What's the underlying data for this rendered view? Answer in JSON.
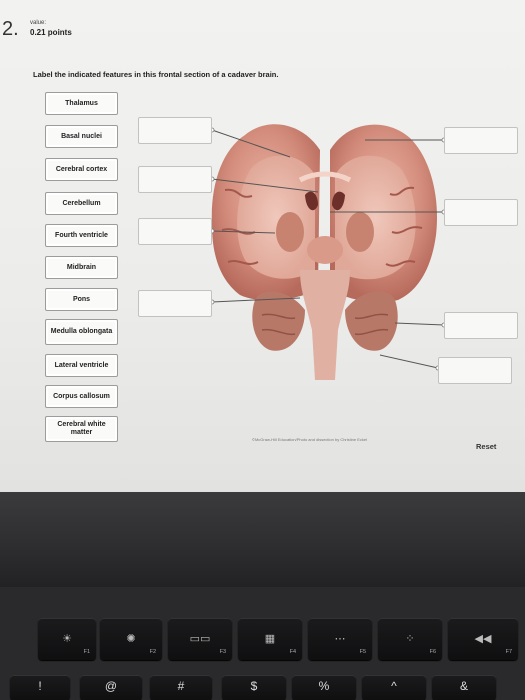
{
  "question": {
    "number": "2.",
    "value_label": "value:",
    "points": "0.21 points",
    "prompt": "Label the indicated features in this frontal section of a cadaver brain."
  },
  "labels": [
    "Thalamus",
    "Basal nuclei",
    "Cerebral cortex",
    "Cerebellum",
    "Fourth ventricle",
    "Midbrain",
    "Pons",
    "Medulla oblongata",
    "Lateral ventricle",
    "Corpus callosum",
    "Cerebral white matter"
  ],
  "credit": "©McGraw-Hill Education/Photo and dissection by Christine Eckel",
  "reset_label": "Reset",
  "keyboard": {
    "function_keys": [
      {
        "icon": "brightness-down-icon",
        "glyph": "☀",
        "fn": "F1"
      },
      {
        "icon": "brightness-up-icon",
        "glyph": "✺",
        "fn": "F2"
      },
      {
        "icon": "mission-control-icon",
        "glyph": "▭▭",
        "fn": "F3"
      },
      {
        "icon": "launchpad-icon",
        "glyph": "▦",
        "fn": "F4"
      },
      {
        "icon": "keyboard-light-down-icon",
        "glyph": "⋯",
        "fn": "F5"
      },
      {
        "icon": "keyboard-light-up-icon",
        "glyph": "⁘",
        "fn": "F6"
      },
      {
        "icon": "rewind-icon",
        "glyph": "◀◀",
        "fn": "F7"
      }
    ],
    "number_keys": [
      "!",
      "@",
      "#",
      "$",
      "%",
      "^",
      "&"
    ]
  }
}
